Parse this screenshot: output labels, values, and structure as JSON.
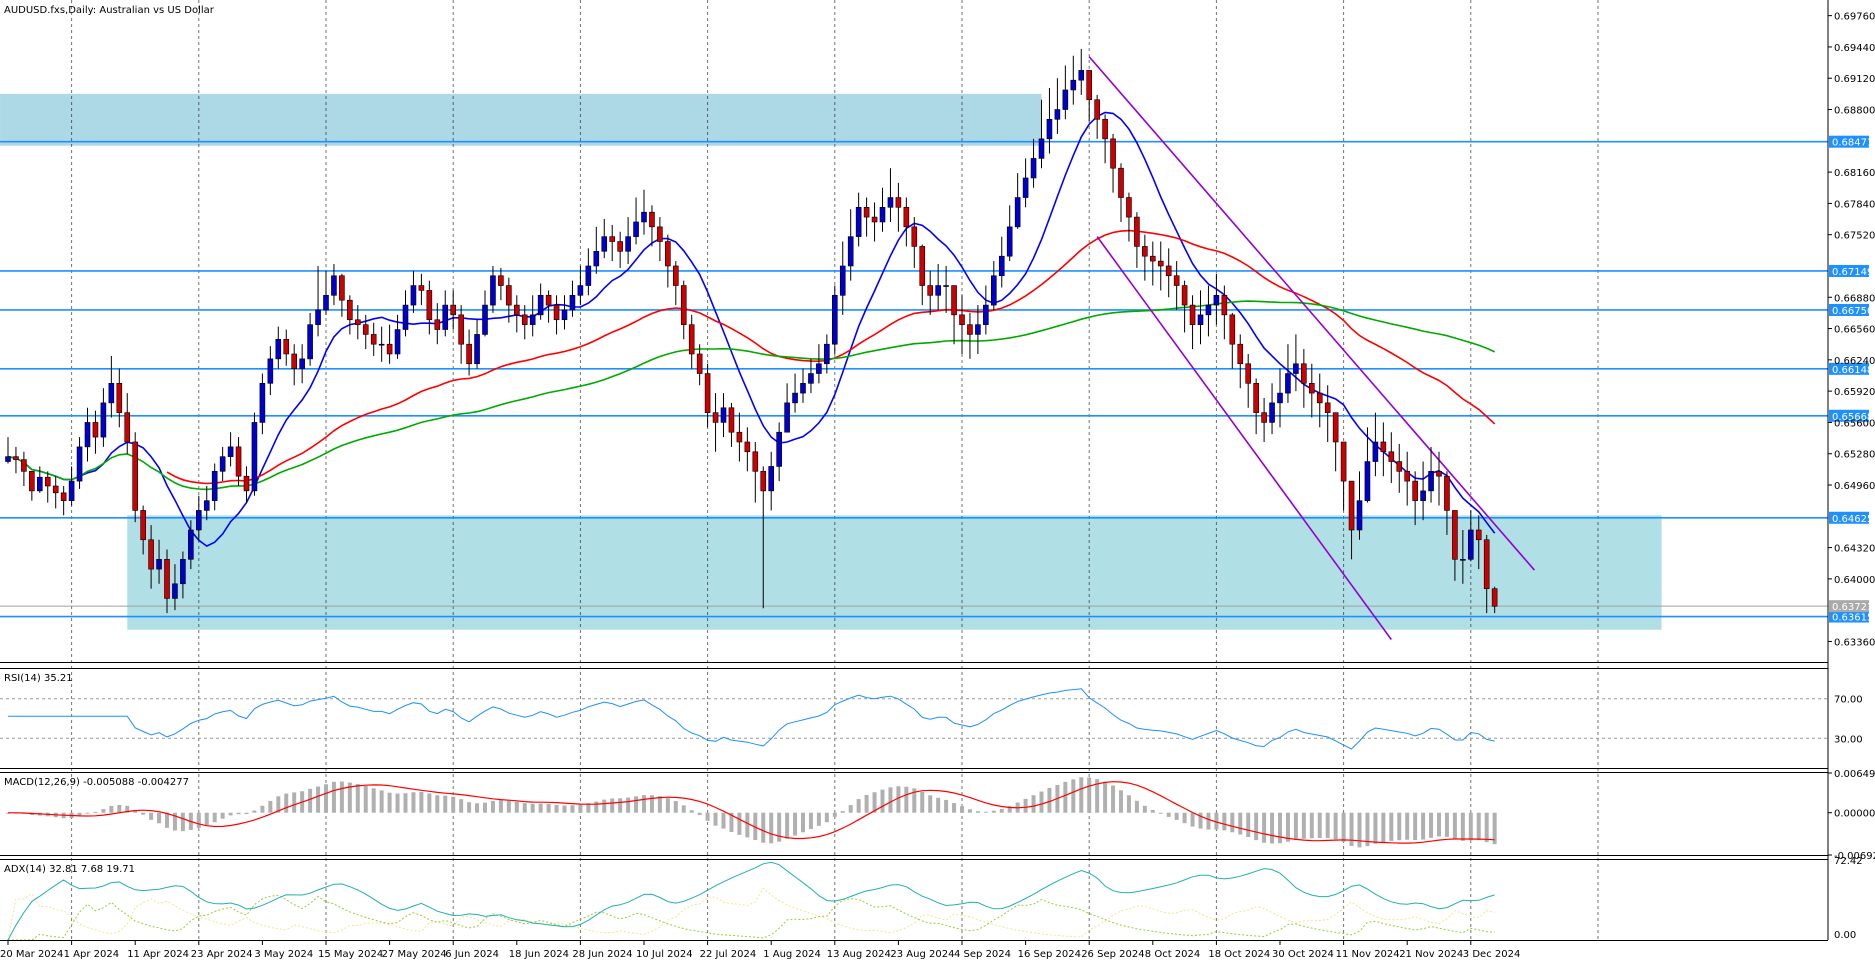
{
  "chart_data": {
    "type": "candlestick",
    "symbol_title": "AUDUSD.fxs,Daily:  Australian vs US Dollar",
    "price_axis": {
      "ylim": [
        0.6315,
        0.6992
      ],
      "ticks": [
        "0.69760",
        "0.69440",
        "0.69120",
        "0.68800",
        "0.68160",
        "0.67840",
        "0.67520",
        "0.66880",
        "0.66560",
        "0.66240",
        "0.65920",
        "0.65600",
        "0.65280",
        "0.64960",
        "0.64320",
        "0.64000",
        "0.63360"
      ]
    },
    "x_axis": {
      "labels": [
        {
          "text": "20 Mar 2024",
          "i": 0
        },
        {
          "text": "1 Apr 2024",
          "i": 8
        },
        {
          "text": "11 Apr 2024",
          "i": 16
        },
        {
          "text": "23 Apr 2024",
          "i": 24
        },
        {
          "text": "3 May 2024",
          "i": 32
        },
        {
          "text": "15 May 2024",
          "i": 40
        },
        {
          "text": "27 May 2024",
          "i": 48
        },
        {
          "text": "6 Jun 2024",
          "i": 56
        },
        {
          "text": "18 Jun 2024",
          "i": 64
        },
        {
          "text": "28 Jun 2024",
          "i": 72
        },
        {
          "text": "10 Jul 2024",
          "i": 80
        },
        {
          "text": "22 Jul 2024",
          "i": 88
        },
        {
          "text": "1 Aug 2024",
          "i": 96
        },
        {
          "text": "13 Aug 2024",
          "i": 104
        },
        {
          "text": "23 Aug 2024",
          "i": 112
        },
        {
          "text": "4 Sep 2024",
          "i": 120
        },
        {
          "text": "16 Sep 2024",
          "i": 128
        },
        {
          "text": "26 Sep 2024",
          "i": 136
        },
        {
          "text": "8 Oct 2024",
          "i": 144
        },
        {
          "text": "18 Oct 2024",
          "i": 152
        },
        {
          "text": "30 Oct 2024",
          "i": 160
        },
        {
          "text": "11 Nov 2024",
          "i": 168
        },
        {
          "text": "21 Nov 2024",
          "i": 176
        },
        {
          "text": "3 Dec 2024",
          "i": 184
        }
      ],
      "grid_i": [
        8,
        24,
        40,
        56,
        72,
        88,
        104,
        120,
        136,
        152,
        168,
        184,
        200
      ]
    },
    "closes": [
      0.6525,
      0.6522,
      0.651,
      0.649,
      0.6504,
      0.6495,
      0.6488,
      0.648,
      0.65,
      0.6535,
      0.656,
      0.6545,
      0.658,
      0.66,
      0.657,
      0.654,
      0.647,
      0.644,
      0.641,
      0.642,
      0.638,
      0.6395,
      0.642,
      0.645,
      0.647,
      0.648,
      0.651,
      0.6525,
      0.6535,
      0.6505,
      0.649,
      0.656,
      0.66,
      0.6625,
      0.6645,
      0.663,
      0.6615,
      0.6625,
      0.666,
      0.6675,
      0.669,
      0.671,
      0.6685,
      0.6665,
      0.666,
      0.665,
      0.664,
      0.664,
      0.663,
      0.6655,
      0.668,
      0.67,
      0.6695,
      0.6665,
      0.6655,
      0.668,
      0.667,
      0.664,
      0.662,
      0.665,
      0.668,
      0.671,
      0.67,
      0.668,
      0.667,
      0.666,
      0.667,
      0.669,
      0.668,
      0.6665,
      0.6675,
      0.669,
      0.67,
      0.672,
      0.6735,
      0.675,
      0.6745,
      0.6735,
      0.675,
      0.6765,
      0.6775,
      0.676,
      0.6745,
      0.672,
      0.67,
      0.666,
      0.663,
      0.661,
      0.657,
      0.656,
      0.6575,
      0.655,
      0.654,
      0.653,
      0.651,
      0.649,
      0.6515,
      0.655,
      0.658,
      0.659,
      0.66,
      0.661,
      0.662,
      0.664,
      0.669,
      0.672,
      0.675,
      0.678,
      0.677,
      0.6765,
      0.678,
      0.679,
      0.678,
      0.676,
      0.674,
      0.67,
      0.669,
      0.67,
      0.67,
      0.667,
      0.666,
      0.665,
      0.666,
      0.668,
      0.671,
      0.673,
      0.676,
      0.679,
      0.681,
      0.683,
      0.685,
      0.687,
      0.688,
      0.69,
      0.691,
      0.692,
      0.689,
      0.687,
      0.685,
      0.682,
      0.679,
      0.677,
      0.674,
      0.673,
      0.6725,
      0.672,
      0.671,
      0.67,
      0.668,
      0.666,
      0.667,
      0.668,
      0.669,
      0.667,
      0.664,
      0.662,
      0.66,
      0.657,
      0.656,
      0.658,
      0.659,
      0.661,
      0.662,
      0.66,
      0.659,
      0.658,
      0.657,
      0.654,
      0.65,
      0.645,
      0.648,
      0.652,
      0.654,
      0.653,
      0.652,
      0.651,
      0.65,
      0.648,
      0.649,
      0.651,
      0.6505,
      0.647,
      0.642,
      0.642,
      0.645,
      0.644,
      0.639,
      0.6372
    ],
    "ranges": [
      [
        0.6518,
        0.6545
      ],
      [
        0.6508,
        0.6535
      ],
      [
        0.6495,
        0.653
      ],
      [
        0.648,
        0.651
      ],
      [
        0.6488,
        0.6515
      ],
      [
        0.6478,
        0.651
      ],
      [
        0.6472,
        0.6505
      ],
      [
        0.6465,
        0.6495
      ],
      [
        0.6475,
        0.6515
      ],
      [
        0.6492,
        0.6545
      ],
      [
        0.652,
        0.6575
      ],
      [
        0.6528,
        0.6572
      ],
      [
        0.6535,
        0.6595
      ],
      [
        0.6565,
        0.6628
      ],
      [
        0.6555,
        0.6615
      ],
      [
        0.6528,
        0.659
      ],
      [
        0.6458,
        0.655
      ],
      [
        0.6425,
        0.6475
      ],
      [
        0.639,
        0.6455
      ],
      [
        0.6395,
        0.644
      ],
      [
        0.6365,
        0.643
      ],
      [
        0.6368,
        0.6415
      ],
      [
        0.638,
        0.6428
      ],
      [
        0.641,
        0.646
      ],
      [
        0.644,
        0.6485
      ],
      [
        0.646,
        0.6495
      ],
      [
        0.647,
        0.6518
      ],
      [
        0.65,
        0.6535
      ],
      [
        0.6515,
        0.655
      ],
      [
        0.6495,
        0.6545
      ],
      [
        0.6478,
        0.6515
      ],
      [
        0.6485,
        0.657
      ],
      [
        0.6548,
        0.661
      ],
      [
        0.6588,
        0.6638
      ],
      [
        0.6615,
        0.6658
      ],
      [
        0.6618,
        0.6655
      ],
      [
        0.6598,
        0.664
      ],
      [
        0.66,
        0.664
      ],
      [
        0.6618,
        0.6672
      ],
      [
        0.6648,
        0.672
      ],
      [
        0.667,
        0.6715
      ],
      [
        0.668,
        0.6722
      ],
      [
        0.6668,
        0.6712
      ],
      [
        0.665,
        0.669
      ],
      [
        0.6645,
        0.668
      ],
      [
        0.6635,
        0.667
      ],
      [
        0.6628,
        0.6662
      ],
      [
        0.6622,
        0.6658
      ],
      [
        0.662,
        0.666
      ],
      [
        0.6625,
        0.667
      ],
      [
        0.6648,
        0.6695
      ],
      [
        0.6672,
        0.6715
      ],
      [
        0.668,
        0.6712
      ],
      [
        0.665,
        0.6705
      ],
      [
        0.664,
        0.6682
      ],
      [
        0.6648,
        0.6695
      ],
      [
        0.6655,
        0.6695
      ],
      [
        0.662,
        0.668
      ],
      [
        0.6608,
        0.6655
      ],
      [
        0.6615,
        0.6665
      ],
      [
        0.6648,
        0.6695
      ],
      [
        0.6672,
        0.672
      ],
      [
        0.6685,
        0.6718
      ],
      [
        0.6662,
        0.6708
      ],
      [
        0.6652,
        0.669
      ],
      [
        0.6645,
        0.668
      ],
      [
        0.6648,
        0.669
      ],
      [
        0.6665,
        0.6702
      ],
      [
        0.6662,
        0.6695
      ],
      [
        0.665,
        0.669
      ],
      [
        0.6655,
        0.669
      ],
      [
        0.6668,
        0.6705
      ],
      [
        0.668,
        0.672
      ],
      [
        0.669,
        0.6738
      ],
      [
        0.6712,
        0.676
      ],
      [
        0.6728,
        0.6768
      ],
      [
        0.6725,
        0.6762
      ],
      [
        0.6718,
        0.6755
      ],
      [
        0.6722,
        0.677
      ],
      [
        0.6742,
        0.679
      ],
      [
        0.6752,
        0.6798
      ],
      [
        0.674,
        0.6782
      ],
      [
        0.6725,
        0.677
      ],
      [
        0.6698,
        0.6752
      ],
      [
        0.668,
        0.6725
      ],
      [
        0.6645,
        0.6705
      ],
      [
        0.6615,
        0.667
      ],
      [
        0.6598,
        0.664
      ],
      [
        0.6555,
        0.662
      ],
      [
        0.653,
        0.659
      ],
      [
        0.6545,
        0.659
      ],
      [
        0.6535,
        0.658
      ],
      [
        0.652,
        0.657
      ],
      [
        0.651,
        0.6555
      ],
      [
        0.6478,
        0.654
      ],
      [
        0.637,
        0.6515
      ],
      [
        0.647,
        0.653
      ],
      [
        0.65,
        0.656
      ],
      [
        0.655,
        0.66
      ],
      [
        0.657,
        0.661
      ],
      [
        0.658,
        0.6615
      ],
      [
        0.659,
        0.6625
      ],
      [
        0.66,
        0.664
      ],
      [
        0.661,
        0.665
      ],
      [
        0.663,
        0.67
      ],
      [
        0.667,
        0.6745
      ],
      [
        0.6705,
        0.6778
      ],
      [
        0.674,
        0.6795
      ],
      [
        0.675,
        0.679
      ],
      [
        0.6745,
        0.6785
      ],
      [
        0.6755,
        0.68
      ],
      [
        0.6765,
        0.682
      ],
      [
        0.6755,
        0.6805
      ],
      [
        0.674,
        0.679
      ],
      [
        0.6718,
        0.677
      ],
      [
        0.668,
        0.6742
      ],
      [
        0.667,
        0.6715
      ],
      [
        0.6675,
        0.6722
      ],
      [
        0.6672,
        0.672
      ],
      [
        0.664,
        0.67
      ],
      [
        0.663,
        0.669
      ],
      [
        0.6625,
        0.6672
      ],
      [
        0.663,
        0.668
      ],
      [
        0.665,
        0.67
      ],
      [
        0.6675,
        0.6725
      ],
      [
        0.6698,
        0.675
      ],
      [
        0.6725,
        0.6782
      ],
      [
        0.6758,
        0.6815
      ],
      [
        0.678,
        0.683
      ],
      [
        0.68,
        0.685
      ],
      [
        0.682,
        0.689
      ],
      [
        0.6835,
        0.6902
      ],
      [
        0.6855,
        0.6912
      ],
      [
        0.687,
        0.6925
      ],
      [
        0.6885,
        0.6935
      ],
      [
        0.6895,
        0.6942
      ],
      [
        0.6868,
        0.692
      ],
      [
        0.685,
        0.6895
      ],
      [
        0.6825,
        0.6875
      ],
      [
        0.6795,
        0.6855
      ],
      [
        0.6765,
        0.6825
      ],
      [
        0.6745,
        0.6795
      ],
      [
        0.6718,
        0.6775
      ],
      [
        0.6705,
        0.6752
      ],
      [
        0.67,
        0.6745
      ],
      [
        0.6695,
        0.6745
      ],
      [
        0.6688,
        0.6738
      ],
      [
        0.6675,
        0.6725
      ],
      [
        0.6652,
        0.6705
      ],
      [
        0.6635,
        0.669
      ],
      [
        0.664,
        0.6695
      ],
      [
        0.6648,
        0.67
      ],
      [
        0.666,
        0.6712
      ],
      [
        0.6645,
        0.67
      ],
      [
        0.6615,
        0.6672
      ],
      [
        0.6595,
        0.665
      ],
      [
        0.6575,
        0.663
      ],
      [
        0.6548,
        0.6605
      ],
      [
        0.654,
        0.6585
      ],
      [
        0.6548,
        0.66
      ],
      [
        0.6555,
        0.6615
      ],
      [
        0.658,
        0.664
      ],
      [
        0.6592,
        0.665
      ],
      [
        0.6575,
        0.6635
      ],
      [
        0.6565,
        0.662
      ],
      [
        0.6555,
        0.661
      ],
      [
        0.654,
        0.6598
      ],
      [
        0.651,
        0.6568
      ],
      [
        0.647,
        0.6535
      ],
      [
        0.642,
        0.6492
      ],
      [
        0.644,
        0.651
      ],
      [
        0.6478,
        0.6555
      ],
      [
        0.6505,
        0.657
      ],
      [
        0.6505,
        0.656
      ],
      [
        0.6498,
        0.655
      ],
      [
        0.6488,
        0.6538
      ],
      [
        0.6475,
        0.653
      ],
      [
        0.6455,
        0.651
      ],
      [
        0.646,
        0.652
      ],
      [
        0.6478,
        0.6535
      ],
      [
        0.6475,
        0.653
      ],
      [
        0.6445,
        0.651
      ],
      [
        0.6398,
        0.647
      ],
      [
        0.6395,
        0.645
      ],
      [
        0.6418,
        0.647
      ],
      [
        0.641,
        0.6465
      ],
      [
        0.6365,
        0.6445
      ],
      [
        0.6365,
        0.6392
      ]
    ],
    "price_levels": [
      {
        "value": 0.68471,
        "label": "0.68471"
      },
      {
        "value": 0.67149,
        "label": "0.67149"
      },
      {
        "value": 0.6675,
        "label": "0.66750"
      },
      {
        "value": 0.66148,
        "label": "0.66148"
      },
      {
        "value": 0.65668,
        "label": "0.65668"
      },
      {
        "value": 0.64625,
        "label": "0.64625"
      },
      {
        "value": 0.63615,
        "label": "0.63615"
      }
    ],
    "current_price": {
      "value": 0.63721,
      "label": "0.63721"
    },
    "zones": [
      {
        "from_i": -1,
        "to_i": 130,
        "low": 0.6843,
        "high": 0.6896
      },
      {
        "from_i": 15,
        "to_i": 208,
        "low": 0.6348,
        "high": 0.6465
      }
    ],
    "channel": {
      "upper": {
        "i1": 136,
        "p1": 0.6934,
        "i2": 192,
        "p2": 0.6409
      },
      "lower": {
        "i1": 137,
        "p1": 0.675,
        "i2": 174,
        "p2": 0.6338
      }
    },
    "moving_averages": [
      {
        "color": "#0000ff",
        "kind": "sma",
        "period": 10
      },
      {
        "color": "#ff0000",
        "kind": "ema",
        "period": 50,
        "start_i": 20
      },
      {
        "color": "#00aa00",
        "kind": "sma",
        "period": 200,
        "start_i": 0
      }
    ],
    "rsi": {
      "title": "RSI(14) 35.21",
      "levels": [
        "70.00",
        "30.00"
      ],
      "ylim": [
        0,
        100
      ]
    },
    "macd": {
      "title": "MACD(12,26,9) -0.005088 -0.004277",
      "levels": [
        "0.006498",
        "0.000000",
        "-0.006920"
      ],
      "ylim": [
        -0.00692,
        0.006498
      ]
    },
    "adx": {
      "title": "ADX(14) 32.81 7.68 19.71",
      "levels": [
        "72.42",
        "0.00"
      ],
      "ylim": [
        0,
        72.42
      ]
    },
    "colors": {
      "bull": "#0000cd",
      "bear": "#cc0000",
      "level_line": "#1e90ff",
      "tag_bg": "#1e90ff",
      "zone_top": "#add8e6",
      "zone_bottom": "#b0dfe6",
      "channel": "#9400d3",
      "rsi": "#1e90ff",
      "macd_signal": "#ff0000",
      "macd_hist": "#b0b0b0",
      "adx_main": "#20b2aa",
      "adx_pos": "#9acd32",
      "adx_neg": "#f0e68c"
    }
  }
}
